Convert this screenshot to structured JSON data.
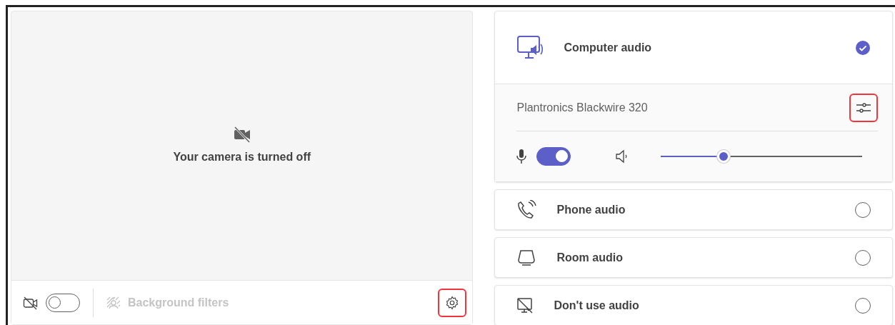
{
  "camera_preview": {
    "message": "Your camera is turned off"
  },
  "camera_bar": {
    "camera_on": false,
    "background_filters": {
      "label": "Background filters",
      "disabled": true
    },
    "settings_highlighted": true
  },
  "audio_options": [
    {
      "kind": "computer",
      "label": "Computer audio",
      "selected": true,
      "device": {
        "name": "Plantronics Blackwire 320",
        "settings_highlighted": true,
        "mic_on": true,
        "volume": {
          "level": 0.31
        }
      }
    },
    {
      "kind": "phone",
      "label": "Phone audio",
      "selected": false
    },
    {
      "kind": "room",
      "label": "Room audio",
      "selected": false
    },
    {
      "kind": "none",
      "label": "Don't use audio",
      "selected": false
    }
  ]
}
